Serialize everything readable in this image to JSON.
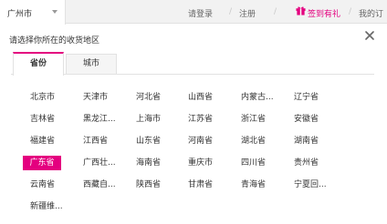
{
  "topbar": {
    "city": "广州市",
    "login": "请登录",
    "sep": "/",
    "register": "注册",
    "checkin": "签到有礼",
    "my_orders": "我的订"
  },
  "panel": {
    "title": "请选择你所在的收货地区",
    "tabs": [
      {
        "label": "省份",
        "active": true
      },
      {
        "label": "城市",
        "active": false
      }
    ],
    "provinces": [
      [
        "北京市",
        "天津市",
        "河北省",
        "山西省",
        "内蒙古...",
        "辽宁省"
      ],
      [
        "吉林省",
        "黑龙江...",
        "上海市",
        "江苏省",
        "浙江省",
        "安徽省"
      ],
      [
        "福建省",
        "江西省",
        "山东省",
        "河南省",
        "湖北省",
        "湖南省"
      ],
      [
        "广东省",
        "广西壮...",
        "海南省",
        "重庆市",
        "四川省",
        "贵州省"
      ],
      [
        "云南省",
        "西藏自...",
        "陕西省",
        "甘肃省",
        "青海省",
        "宁夏回..."
      ],
      [
        "新疆维..."
      ]
    ],
    "selected_province": "广东省"
  },
  "colors": {
    "accent": "#e4007f",
    "topbar_bg": "#f2f2f2",
    "border": "#e2e2e2"
  },
  "icons": {
    "caret": "chevron-down-icon",
    "gift": "gift-icon",
    "close": "close-icon"
  }
}
